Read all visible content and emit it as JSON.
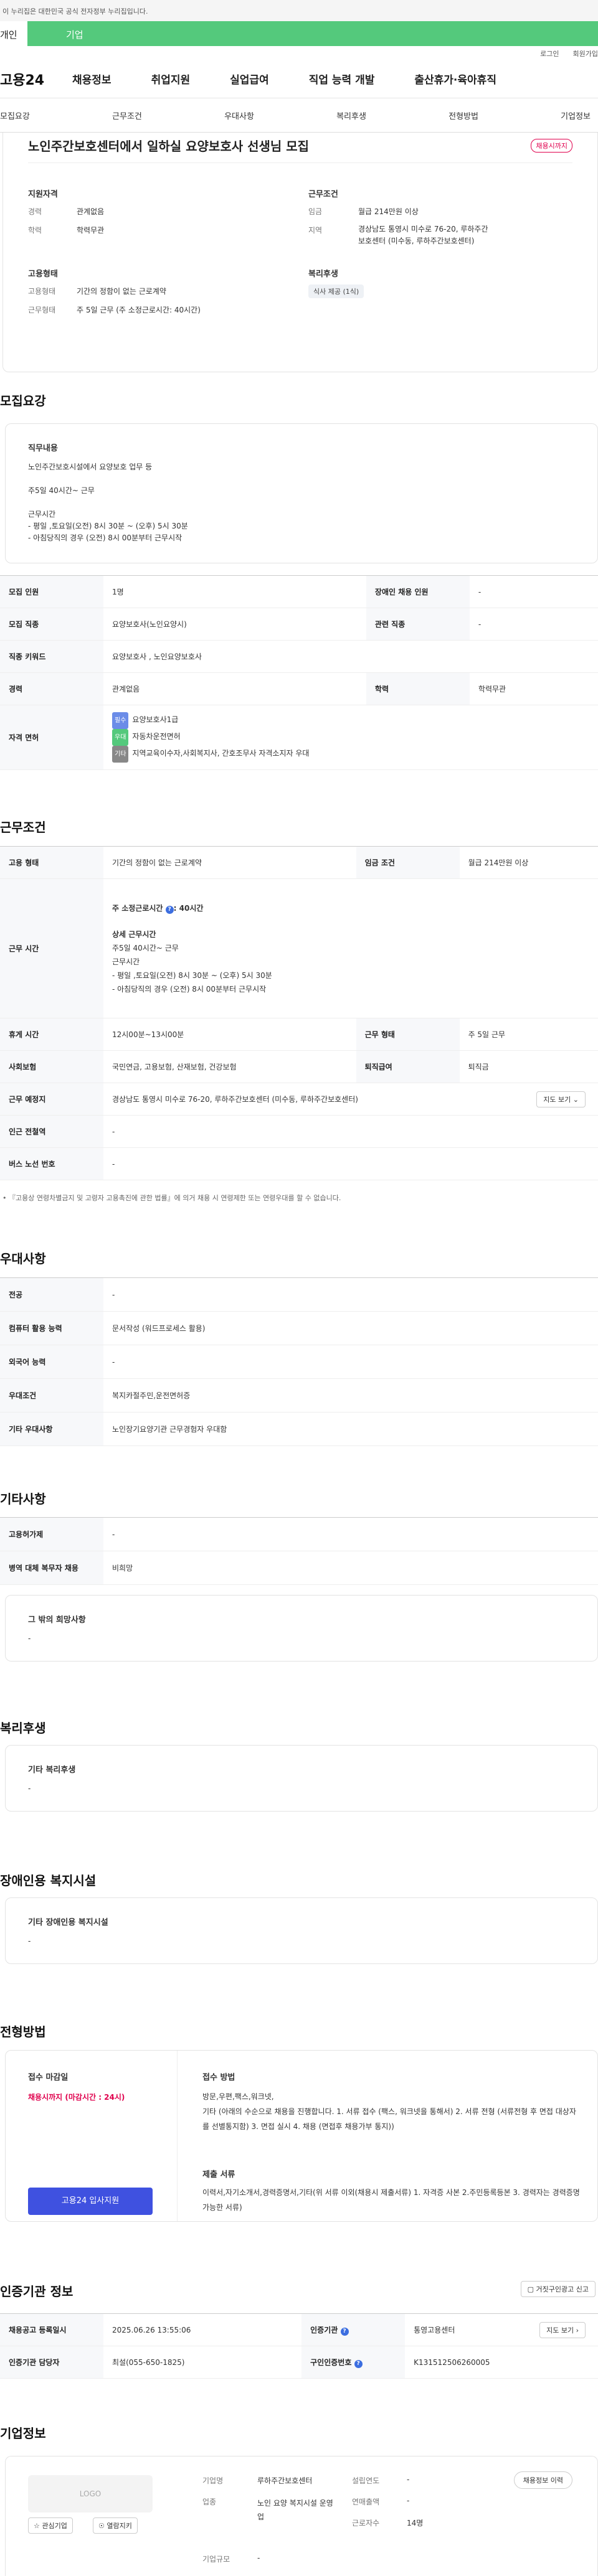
{
  "gov_banner": "이 누리집은 대한민국 공식 전자정부 누리집입니다.",
  "user_tabs": {
    "left": "개인",
    "right": "기업"
  },
  "util": {
    "login": "로그인",
    "signup": "회원가입"
  },
  "gnb": {
    "logo": "고용24",
    "menu": [
      "채용정보",
      "취업지원",
      "실업급여",
      "직업 능력 개발",
      "출산휴가·육아휴직"
    ]
  },
  "anchors": [
    "모집요강",
    "근무조건",
    "우대사항",
    "복리후생",
    "전형방법",
    "기업정보"
  ],
  "summary": {
    "title": "노인주간보호센터에서 일하실 요양보호사 선생님 모집",
    "status_badge": "채용시까지",
    "qual_heading": "지원자격",
    "career_label": "경력",
    "career_value": "관계없음",
    "edu_label": "학력",
    "edu_value": "학력무관",
    "cond_heading": "근무조건",
    "wage_label": "임금",
    "wage_value": "월급 214만원 이상",
    "region_label": "지역",
    "region_value": "경상남도 통영시 미수로 76-20, 루하주간보호센터 (미수동, 루하주간보호센터)",
    "emp_heading": "고용형태",
    "emp_label": "고용형태",
    "emp_value": "기간의 정함이 없는 근로계약",
    "worktype_label": "근무형태",
    "worktype_value": "주 5일 근무 (주 소정근로시간: 40시간)",
    "welfare_heading": "복리후생",
    "welfare_chip": "식사 제공 (1식)"
  },
  "recruit": {
    "heading": "모집요강",
    "duty_title": "직무내용",
    "duty_lines": [
      "노인주간보호시설에서 요양보호 업무 등",
      "주5일 40시간~ 근무",
      "근무시간",
      "- 평일 ,토요일(오전) 8시 30분 ~ (오후) 5시 30분",
      "- 아침당직의 경우 (오전) 8시 00분부터 근무시작"
    ],
    "rows": {
      "count_label": "모집 인원",
      "count_value": "1명",
      "disabled_label": "장애인 채용 인원",
      "disabled_value": "-",
      "job_label": "모집 직종",
      "job_value": "요양보호사(노인요양시)",
      "related_label": "관련 직종",
      "related_value": "-",
      "kw_label": "직종 키워드",
      "kw_value": "요양보호사 , 노인요양보호사",
      "career_label": "경력",
      "career_value": "관계없음",
      "edu_label": "학력",
      "edu_value": "학력무관",
      "license_label": "자격 면허",
      "licenses": [
        {
          "chip": "필수",
          "text": "요양보호사1급"
        },
        {
          "chip": "우대",
          "text": "자동차운전면허"
        },
        {
          "chip": "기타",
          "text": "지역교육이수자,사회복지사, 간호조무사 자격소지자 우대"
        }
      ]
    }
  },
  "workcond": {
    "heading": "근무조건",
    "emp_label": "고용 형태",
    "emp_value": "기간의 정함이 없는 근로계약",
    "wage_label": "임금 조건",
    "wage_value": "월급 214만원 이상",
    "hours_label": "근무 시간",
    "hours_weekly": "주 소정근로시간",
    "hours_weekly_value": ": 40시간",
    "hours_detail_title": "상세 근무시간",
    "hours_lines": [
      "주5일 40시간~ 근무",
      "근무시간",
      "- 평일 ,토요일(오전) 8시 30분 ~ (오후) 5시 30분",
      "- 아침당직의 경우 (오전) 8시 00분부터 근무시작"
    ],
    "break_label": "휴게 시간",
    "break_value": "12시00분~13시00분",
    "type_label": "근무 형태",
    "type_value": "주 5일 근무",
    "insurance_label": "사회보험",
    "insurance_value": "국민연금, 고용보험, 산재보험, 건강보험",
    "severance_label": "퇴직급여",
    "severance_value": "퇴직금",
    "place_label": "근무 예정지",
    "place_value": "경상남도 통영시 미수로 76-20, 루하주간보호센터 (미수동, 루하주간보호센터)",
    "map_button": "지도 보기",
    "subway_label": "인근 전철역",
    "subway_value": "-",
    "bus_label": "버스 노선 번호",
    "bus_value": "-",
    "note": "『고용상 연령차별금지 및 고령자 고용촉진에 관한 법률』에 의거 채용 시 연령제한 또는 연령우대를 할 수 없습니다."
  },
  "prefer": {
    "heading": "우대사항",
    "rows": [
      {
        "label": "전공",
        "value": "-"
      },
      {
        "label": "컴퓨터 활용 능력",
        "value": "문서작성 (워드프로세스 활용)"
      },
      {
        "label": "외국어 능력",
        "value": "-"
      },
      {
        "label": "우대조건",
        "value": "복지카절주민,운전면허증"
      },
      {
        "label": "기타 우대사항",
        "value": "노인장기요양기관 근무경험자 우대함"
      }
    ]
  },
  "etc": {
    "heading": "기타사항",
    "rows": [
      {
        "label": "고용허가제",
        "value": "-"
      },
      {
        "label": "병역 대체 복무자 채용",
        "value": "비희망"
      }
    ],
    "wish_title": "그 밖의 희망사항",
    "wish_value": "-"
  },
  "welfare": {
    "heading": "복리후생",
    "title": "기타 복리후생",
    "value": "-"
  },
  "disab": {
    "heading": "장애인용 복지시설",
    "title": "기타 장애인용 복지시설",
    "value": "-"
  },
  "selection": {
    "heading": "전형방법",
    "deadline_title": "접수 마감일",
    "deadline_value": "채용시까지 (마감시간 : 24시)",
    "apply_button": "고용24 입사지원",
    "method_title": "접수 방법",
    "method_lines": [
      "방문,우편,팩스,워크넷,",
      "기타 (아래의 수순으로 채용을 진행합니다. 1. 서류 접수 (팩스, 워크넷을 통해서)  2. 서류 전형 (서류전형 후  면접 대상자를 선별통지함)  3. 면접 실시  4. 채용 (면접후 채용가부 통지))"
    ],
    "docs_title": "제출 서류",
    "docs_value": "이력서,자기소개서,경력증명서,기타(위 서류 이외(채용시 제출서류) 1. 자격증 사본      2.주민등록등본 3. 경력자는 경력증명 가능한 서류)"
  },
  "cert": {
    "heading": "인증기관 정보",
    "report_button": "거짓구인광고 신고",
    "date_label": "채용공고 등록일시",
    "date_value": "2025.06.26 13:55:06",
    "agency_label": "인증기관",
    "agency_value": "통영고용센터",
    "map_button": "지도 보기",
    "manager_label": "인증기관 담당자",
    "manager_value": "최설(055-650-1825)",
    "id_label": "구인인증번호",
    "id_value": "K131512506260005"
  },
  "company": {
    "heading": "기업정보",
    "logo_text": "LOGO",
    "fav_button": "관심기업",
    "follow_button": "열람지키",
    "name_label": "기업명",
    "name_value": "루하주간보호센터",
    "industry_label": "업종",
    "industry_value": "노인 요양 복지시설 운영업",
    "scale_label": "기업규모",
    "scale_value": "-",
    "founded_label": "설립연도",
    "founded_value": "-",
    "sales_label": "연매출액",
    "sales_value": "-",
    "staff_label": "근로자수",
    "staff_value": "14명",
    "jobs_button": "채용정보 이력"
  }
}
